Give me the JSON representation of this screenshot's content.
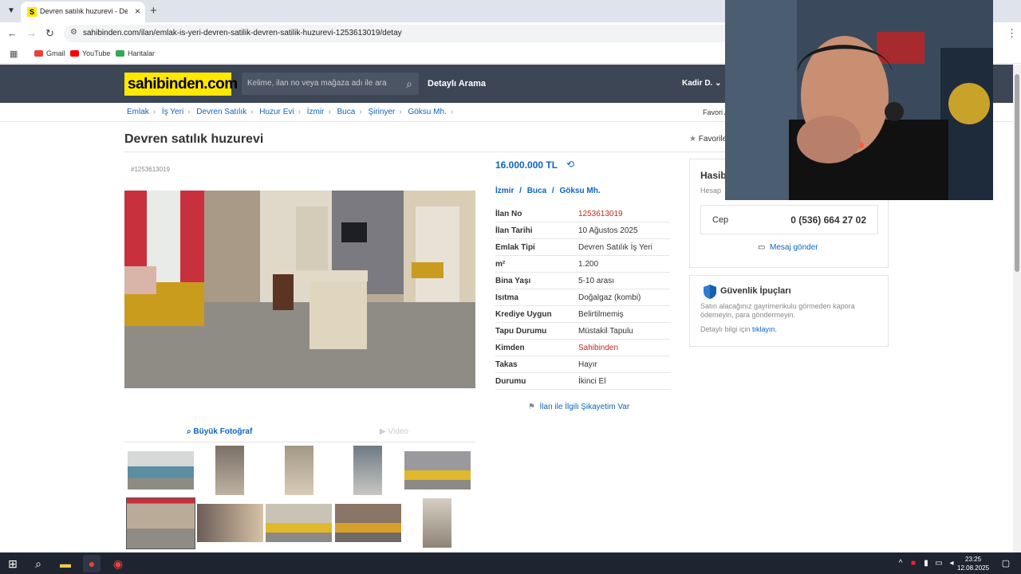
{
  "browser": {
    "tab_title": "Devren satılık huzurevi - Devren",
    "tab_favicon": "S",
    "url": "sahibinden.com/ilan/emlak-is-yeri-devren-satilik-devren-satilik-huzurevi-1253613019/detay",
    "bookmarks": [
      {
        "label": "Gmail",
        "color": "#ea4335"
      },
      {
        "label": "YouTube",
        "color": "#ff0000"
      },
      {
        "label": "Haritalar",
        "color": "#34a853"
      }
    ]
  },
  "header": {
    "logo": "sahibinden.com",
    "search_placeholder": "Kelime, ilan no veya mağaza adı ile ara",
    "advanced_search": "Detaylı Arama",
    "user": "Kadir D."
  },
  "breadcrumb": [
    "Emlak",
    "İş Yeri",
    "Devren Satılık",
    "Huzur Evi",
    "İzmir",
    "Buca",
    "Şirinyer",
    "Göksu Mh."
  ],
  "favorite_searches": "Favori A",
  "listing": {
    "title": "Devren satılık huzurevi",
    "favorites_label": "Favorile",
    "id_label": "#1253613019",
    "price": "16.000.000 TL",
    "location": {
      "city": "İzmir",
      "district": "Buca",
      "neighborhood": "Göksu Mh."
    },
    "details": [
      {
        "key": "İlan No",
        "value": "1253613019",
        "red": true
      },
      {
        "key": "İlan Tarihi",
        "value": "10 Ağustos 2025"
      },
      {
        "key": "Emlak Tipi",
        "value": "Devren Satılık İş Yeri"
      },
      {
        "key": "m²",
        "value": "1.200"
      },
      {
        "key": "Bina Yaşı",
        "value": "5-10 arası"
      },
      {
        "key": "Isıtma",
        "value": "Doğalgaz (kombi)"
      },
      {
        "key": "Krediye Uygun",
        "value": "Belirtilmemiş"
      },
      {
        "key": "Tapu Durumu",
        "value": "Müstakil Tapulu"
      },
      {
        "key": "Kimden",
        "value": "Sahibinden",
        "red": true
      },
      {
        "key": "Takas",
        "value": "Hayır"
      },
      {
        "key": "Durumu",
        "value": "İkinci El"
      }
    ],
    "complaint": "İlan ile İlgili Şikayetim Var",
    "big_photo_label": "Büyük Fotoğraf",
    "video_label": "Video"
  },
  "seller": {
    "name": "Hasib",
    "since": "Hesap",
    "phone_label": "Cep",
    "phone": "0 (536) 664 27 02",
    "message": "Mesaj gönder"
  },
  "security": {
    "title": "Güvenlik İpuçları",
    "text": "Satın alacağınız gayrimenkulu görmeden kapora ödemeyin, para göndermeyin.",
    "detail_prefix": "Detaylı bilgi için",
    "detail_link": "tıklayın."
  },
  "taskbar": {
    "time": "23:25",
    "date": "12.08.2025"
  },
  "colors": {
    "brand_yellow": "#ffe800",
    "header_bg": "#3d4654",
    "link_blue": "#1064bc",
    "accent_red": "#c0292b"
  }
}
